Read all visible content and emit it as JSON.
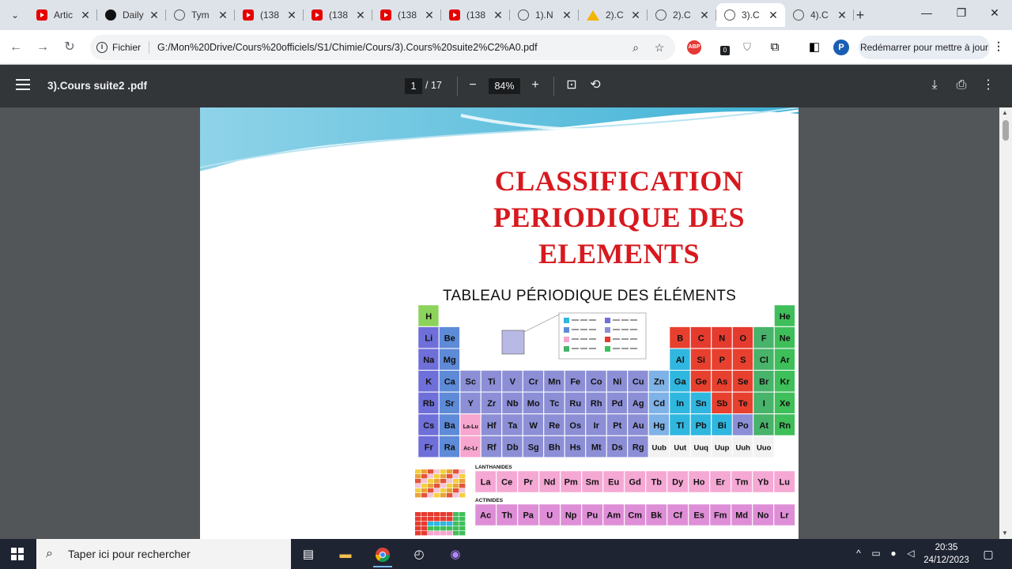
{
  "browser": {
    "tabs": [
      {
        "label": "Artic",
        "icon": "youtube-icon",
        "active": false
      },
      {
        "label": "Daily",
        "icon": "daily-icon",
        "active": false
      },
      {
        "label": "Tym",
        "icon": "globe-icon",
        "active": false
      },
      {
        "label": "(138",
        "icon": "youtube-icon",
        "active": false
      },
      {
        "label": "(138",
        "icon": "youtube-icon",
        "active": false
      },
      {
        "label": "(138",
        "icon": "youtube-icon",
        "active": false
      },
      {
        "label": "(138",
        "icon": "youtube-icon",
        "active": false
      },
      {
        "label": "1).N",
        "icon": "globe-icon",
        "active": false
      },
      {
        "label": "2).C",
        "icon": "drive-icon",
        "active": false
      },
      {
        "label": "2).C",
        "icon": "globe-icon",
        "active": false
      },
      {
        "label": "3).C",
        "icon": "globe-icon",
        "active": true
      },
      {
        "label": "4).C",
        "icon": "globe-icon",
        "active": false
      }
    ],
    "address": {
      "chip": "Fichier",
      "url": "G:/Mon%20Drive/Cours%20officiels/S1/Chimie/Cours/3).Cours%20suite2%C2%A0.pdf"
    },
    "extension_badge": "0",
    "avatar_letter": "P",
    "update_label": "Redémarrer pour mettre à jour"
  },
  "pdf": {
    "title": "3).Cours suite2 .pdf",
    "current_page": "1",
    "total_pages": "/ 17",
    "zoom": "84%"
  },
  "document": {
    "title_lines": [
      "CLASSIFICATION",
      "PERIODIQUE DES",
      "ELEMENTS"
    ],
    "table_title": "TABLEAU PÉRIODIQUE DES ÉLÉMENTS",
    "title_color": "#d7191f",
    "element_symbols": [
      "H",
      "He",
      "Li",
      "Be",
      "B",
      "C",
      "N",
      "O",
      "F",
      "Ne",
      "Na",
      "Mg",
      "Al",
      "Si",
      "P",
      "S",
      "Cl",
      "Ar",
      "K",
      "Ca",
      "Sc",
      "Ti",
      "V",
      "Cr",
      "Mn",
      "Fe",
      "Co",
      "Ni",
      "Cu",
      "Zn",
      "Ga",
      "Ge",
      "As",
      "Se",
      "Br",
      "Kr",
      "Rb",
      "Sr",
      "Y",
      "Zr",
      "Nb",
      "Mo",
      "Tc",
      "Ru",
      "Rh",
      "Pd",
      "Ag",
      "Cd",
      "In",
      "Sn",
      "Sb",
      "Te",
      "I",
      "Xe",
      "Cs",
      "Ba",
      "La-Lu",
      "Hf",
      "Ta",
      "W",
      "Re",
      "Os",
      "Ir",
      "Pt",
      "Au",
      "Hg",
      "Tl",
      "Pb",
      "Bi",
      "Po",
      "At",
      "Rn",
      "Fr",
      "Ra",
      "Ac-Lr",
      "Rf",
      "Db",
      "Sg",
      "Bh",
      "Hs",
      "Mt",
      "Ds",
      "Rg",
      "Uub",
      "Uut",
      "Uuq",
      "Uup",
      "Uuh",
      "Uuo"
    ],
    "lanthanides_label": "LANTHANIDES",
    "lanthanides": [
      "La",
      "Ce",
      "Pr",
      "Nd",
      "Pm",
      "Sm",
      "Eu",
      "Gd",
      "Tb",
      "Dy",
      "Ho",
      "Er",
      "Tm",
      "Yb",
      "Lu"
    ],
    "actinides_label": "ACTINIDES",
    "actinides": [
      "Ac",
      "Th",
      "Pa",
      "U",
      "Np",
      "Pu",
      "Am",
      "Cm",
      "Bk",
      "Cf",
      "Es",
      "Fm",
      "Md",
      "No",
      "Lr"
    ]
  },
  "taskbar": {
    "search_placeholder": "Taper ici pour rechercher",
    "time": "20:35",
    "date": "24/12/2023"
  }
}
